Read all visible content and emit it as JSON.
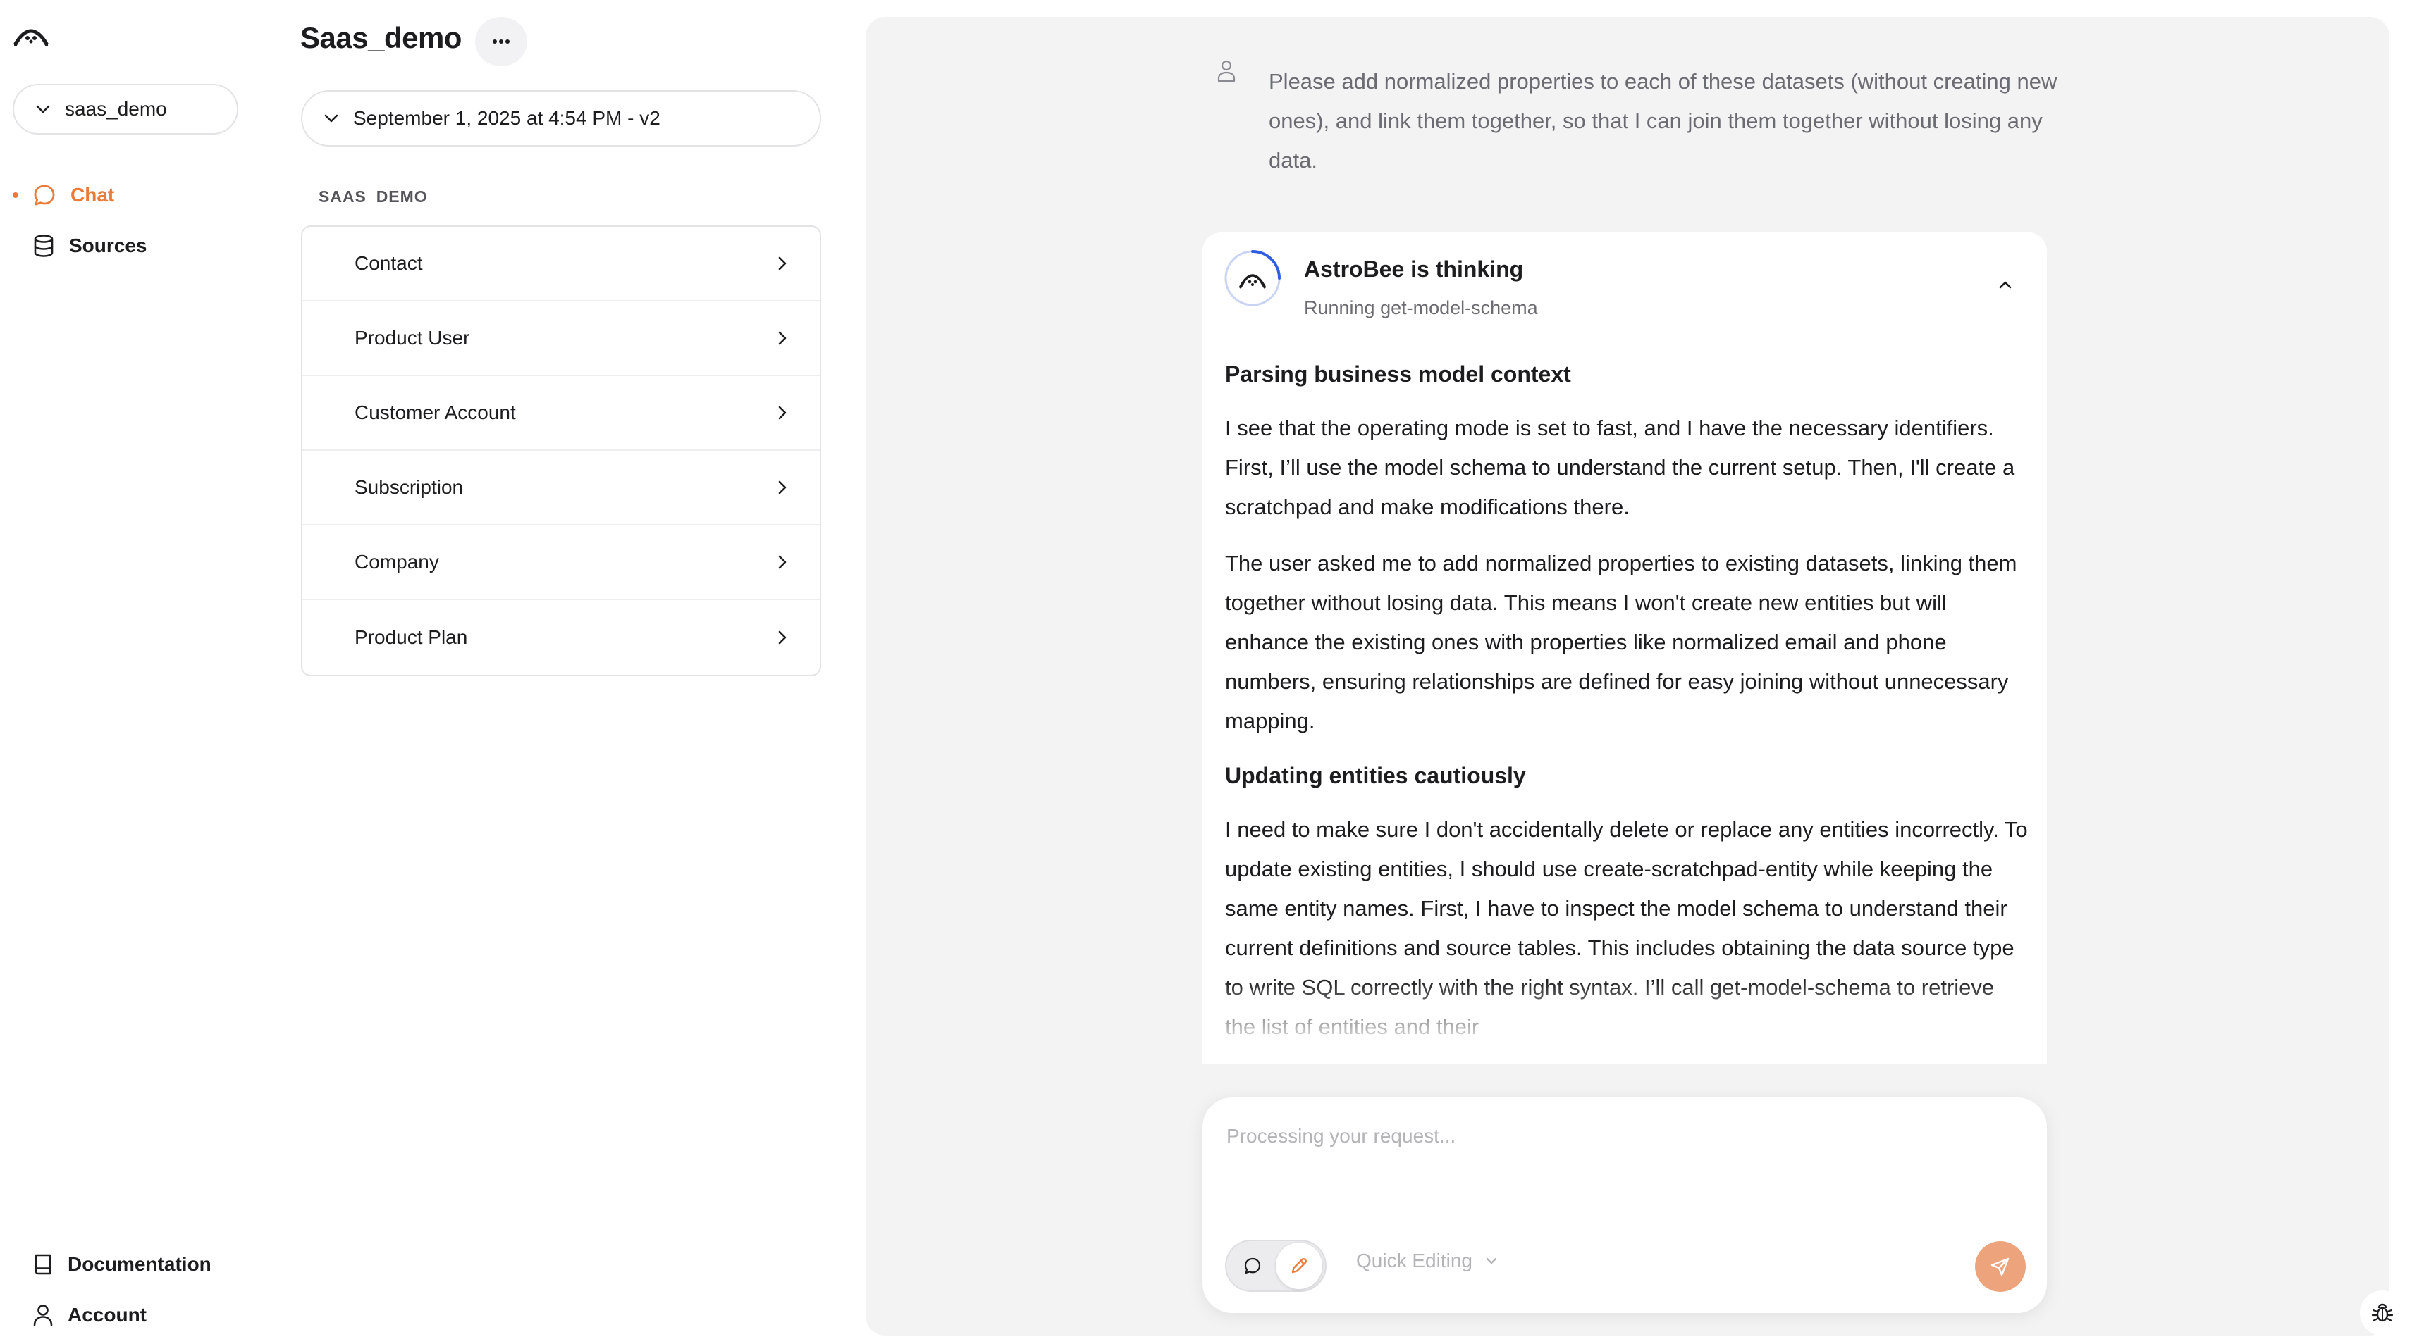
{
  "sidebar": {
    "workspace": "saas_demo",
    "nav": [
      {
        "label": "Chat",
        "icon": "chat-bubble-icon",
        "active": true
      },
      {
        "label": "Sources",
        "icon": "database-icon",
        "active": false
      }
    ],
    "footer": [
      {
        "label": "Documentation",
        "icon": "book-icon"
      },
      {
        "label": "Account",
        "icon": "person-icon"
      }
    ]
  },
  "model": {
    "title": "Saas_demo",
    "version": "September 1, 2025 at 4:54 PM - v2",
    "section_label": "SAAS_DEMO",
    "entities": [
      {
        "label": "Contact"
      },
      {
        "label": "Product User"
      },
      {
        "label": "Customer Account"
      },
      {
        "label": "Subscription"
      },
      {
        "label": "Company"
      },
      {
        "label": "Product Plan"
      }
    ]
  },
  "chat": {
    "user_message": "Please add normalized properties to each of these datasets (without creating new ones), and link them together, so that I can join them together without losing any data.",
    "assistant": {
      "title": "AstroBee is thinking",
      "status": "Running get-model-schema",
      "sections": [
        {
          "heading": "Parsing business model context",
          "paragraphs": [
            "I see that the operating mode is set to fast, and I have the necessary identifiers. First, I’ll use the model schema to understand the current setup. Then, I'll create a scratchpad and make modifications there.",
            "The user asked me to add normalized properties to existing datasets, linking them together without losing data. This means I won't create new entities but will enhance the existing ones with properties like normalized email and phone numbers, ensuring relationships are defined for easy joining without unnecessary mapping."
          ]
        },
        {
          "heading": "Updating entities cautiously",
          "paragraphs": [
            "I need to make sure I don't accidentally delete or replace any entities incorrectly. To update existing entities, I should use create-scratchpad-entity while keeping the same entity names. First, I have to inspect the model schema to understand their current definitions and source tables. This includes obtaining the data source type to write SQL correctly with the right syntax. I’ll call get-model-schema to retrieve the list of entities and their"
          ]
        }
      ]
    },
    "composer": {
      "placeholder": "Processing your request...",
      "mode_label": "Quick Editing"
    }
  },
  "colors": {
    "accent": "#ea7b38",
    "send_button": "#eda37c",
    "panel_bg": "#f3f3f4",
    "spinner": "#2f5fe0"
  }
}
